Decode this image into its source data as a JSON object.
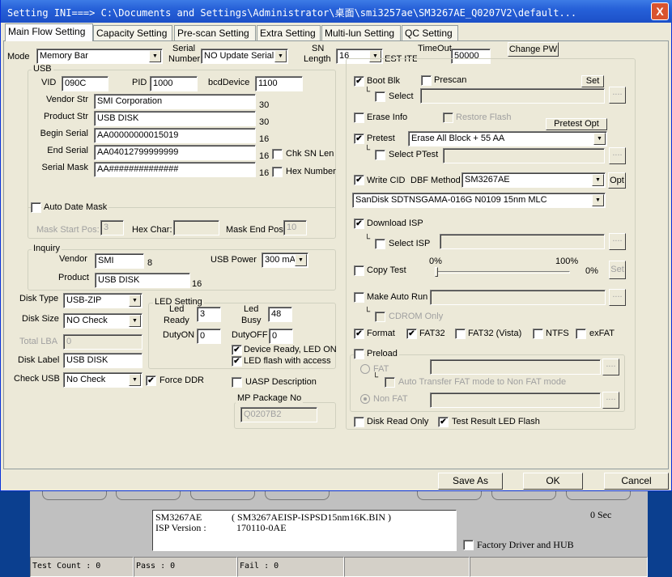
{
  "window": {
    "title": "Setting  INI===> C:\\Documents and Settings\\Administrator\\桌面\\smi3257ae\\SM3267AE_Q0207V2\\default...",
    "close": "X"
  },
  "tabs": [
    "Main Flow Setting",
    "Capacity Setting",
    "Pre-scan Setting",
    "Extra Setting",
    "Multi-lun Setting",
    "QC Setting"
  ],
  "top": {
    "mode_label": "Mode",
    "mode": "Memory Bar",
    "serial_label1": "Serial",
    "serial_label2": "Number",
    "serial": "NO Update Serial",
    "snlen_label1": "SN",
    "snlen_label2": "Length",
    "snlen": "16",
    "test_item": "EST ITEI",
    "timeout_label": "TimeOut",
    "timeout": "50000",
    "change_pw": "Change PW"
  },
  "usb": {
    "title": "USB",
    "vid_label": "VID",
    "vid": "090C",
    "pid_label": "PID",
    "pid": "1000",
    "bcd_label": "bcdDevice",
    "bcd": "1100",
    "rows": [
      {
        "label": "Vendor Str",
        "value": "SMI Corporation",
        "len": "30"
      },
      {
        "label": "Product Str",
        "value": "USB DISK",
        "len": "30"
      },
      {
        "label": "Begin Serial",
        "value": "AA00000000015019",
        "len": "16"
      },
      {
        "label": "End Serial",
        "value": "AA04012799999999",
        "len": "16"
      },
      {
        "label": "Serial Mask",
        "value": "AA##############",
        "len": "16"
      }
    ],
    "chk_sn_len": {
      "label": "Chk SN Len",
      "checked": false
    },
    "hex_number": {
      "label": "Hex Number",
      "checked": false
    },
    "auto_date_mask": {
      "label": "Auto Date Mask",
      "checked": false
    },
    "mask_start_label": "Mask Start Pos:",
    "mask_start": "3",
    "hex_char_label": "Hex Char:",
    "hex_char": "",
    "mask_end_label": "Mask End Pos:",
    "mask_end": "10"
  },
  "inquiry": {
    "title": "Inquiry",
    "vendor_label": "Vendor",
    "vendor": "SMI",
    "vendor_len": "8",
    "product_label": "Product",
    "product": "USB DISK",
    "product_len": "16",
    "usb_power_label": "USB Power",
    "usb_power": "300 mA"
  },
  "disk": {
    "type_label": "Disk Type",
    "type": "USB-ZIP",
    "size_label": "Disk Size",
    "size": "NO Check",
    "lba_label": "Total LBA",
    "lba": "0",
    "label_label": "Disk Label",
    "label": "USB DISK",
    "check_usb_label": "Check USB",
    "check_usb": "No Check",
    "force_ddr": {
      "label": "Force DDR",
      "checked": true
    }
  },
  "led": {
    "title": "LED Setting",
    "ready_label1": "Led",
    "ready_label2": "Ready",
    "ready": "3",
    "busy_label1": "Led",
    "busy_label2": "Busy",
    "busy": "48",
    "duty_on_label": "DutyON",
    "duty_on": "0",
    "duty_off_label": "DutyOFF",
    "duty_off": "0",
    "device_ready": {
      "label": "Device Ready, LED ON",
      "checked": true
    },
    "flash_access": {
      "label": "LED flash with access",
      "checked": true
    }
  },
  "uasp": {
    "label": "UASP Description",
    "checked": false
  },
  "mp_package": {
    "title": "MP Package No",
    "value": "Q0207B2"
  },
  "right": {
    "boot_blk": {
      "label": "Boot Blk",
      "checked": true
    },
    "prescan": {
      "label": "Prescan",
      "checked": false
    },
    "set": "Set",
    "boot_select": {
      "label": "Select",
      "checked": false
    },
    "browse": "....",
    "erase_info": {
      "label": "Erase Info",
      "checked": false
    },
    "restore_flash": {
      "label": "Restore Flash",
      "checked": false
    },
    "pretest_opt": "Pretest Opt",
    "pretest": {
      "label": "Pretest",
      "checked": true
    },
    "pretest_mode": "Erase All Block + 55 AA",
    "select_ptest": {
      "label": "Select PTest",
      "checked": false
    },
    "write_cid": {
      "label": "Write CID",
      "checked": true
    },
    "dbf_label": "DBF Method",
    "dbf": "SM3267AE",
    "opt": "Opt",
    "flash": "SanDisk SDTNSGAMA-016G N0109 15nm MLC",
    "download_isp": {
      "label": "Download ISP",
      "checked": true
    },
    "select_isp": {
      "label": "Select ISP",
      "checked": false
    },
    "copy_test": {
      "label": "Copy Test",
      "checked": false
    },
    "copy_min": "0%",
    "copy_max": "100%",
    "copy_value": "0%",
    "copy_set": "Set",
    "auto_run": {
      "label": "Make Auto Run",
      "checked": false
    },
    "cdrom_only": {
      "label": "CDROM Only",
      "checked": false
    },
    "format": {
      "label": "Format",
      "checked": true
    },
    "fat32": {
      "label": "FAT32",
      "checked": true
    },
    "fat32_vista": {
      "label": "FAT32 (Vista)",
      "checked": false
    },
    "ntfs": {
      "label": "NTFS",
      "checked": false
    },
    "exfat": {
      "label": "exFAT",
      "checked": false
    },
    "preload": {
      "label": "Preload",
      "checked": false
    },
    "fat_radio": "FAT",
    "auto_transfer": {
      "label": "Auto Transfer FAT mode to Non FAT mode",
      "checked": false
    },
    "nonfat_radio": "Non FAT",
    "disk_read_only": {
      "label": "Disk Read Only",
      "checked": false
    },
    "test_led_flash": {
      "label": "Test Result LED Flash",
      "checked": true
    }
  },
  "footer": {
    "save_as": "Save As",
    "ok": "OK",
    "cancel": "Cancel"
  },
  "background": {
    "info_line1a": "SM3267AE",
    "info_line1b": "( SM3267AEISP-ISPSD15nm16K.BIN )",
    "info_line2a": "ISP Version :",
    "info_line2b": "170110-0AE",
    "timer": "0 Sec",
    "factory": {
      "label": "Factory Driver and HUB",
      "checked": false
    },
    "test_count": "Test Count : 0",
    "pass": "Pass : 0",
    "fail": "Fail : 0"
  }
}
